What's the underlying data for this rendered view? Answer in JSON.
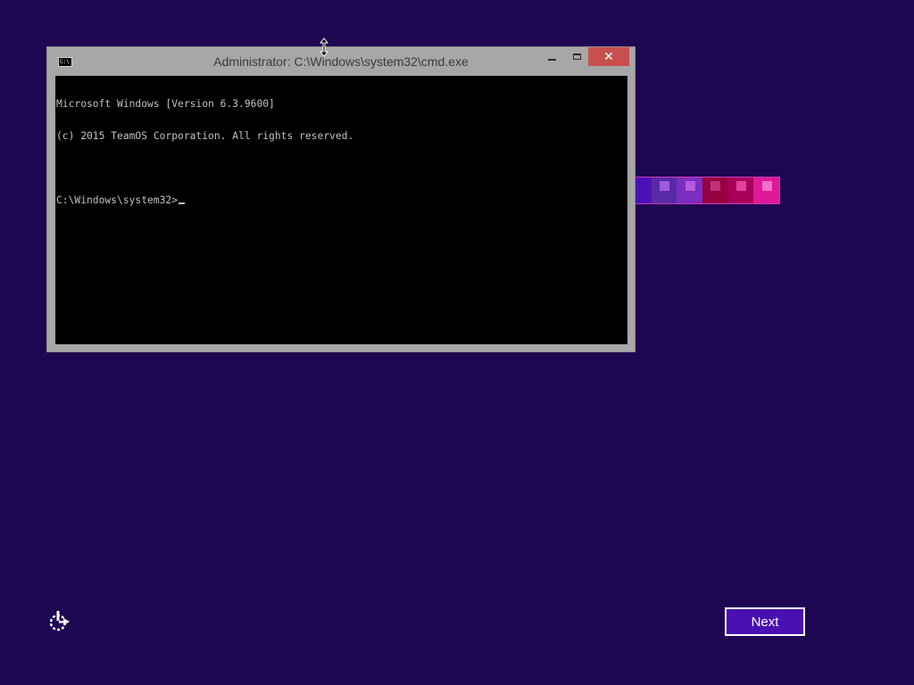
{
  "window": {
    "title": "Administrator: C:\\Windows\\system32\\cmd.exe",
    "icon_label": "C:\\",
    "close_glyph": "✕"
  },
  "console": {
    "lines": [
      "Microsoft Windows [Version 6.3.9600]",
      "(c) 2015 TeamOS Corporation. All rights reserved.",
      "",
      "C:\\Windows\\system32>"
    ]
  },
  "setup": {
    "next_label": "Next"
  },
  "colors": {
    "background": "#1f0652",
    "next_button": "#4a0fb0",
    "close_button": "#c7504f",
    "strip_tiles": [
      "#4b12b8",
      "#5a2aa6",
      "#7b2ec0",
      "#96003f",
      "#a8005a",
      "#e0189a"
    ],
    "strip_squares": [
      "#6a3ad0",
      "#a05be0",
      "#b55be0",
      "#c0307a",
      "#e0409e",
      "#f070c8"
    ]
  }
}
